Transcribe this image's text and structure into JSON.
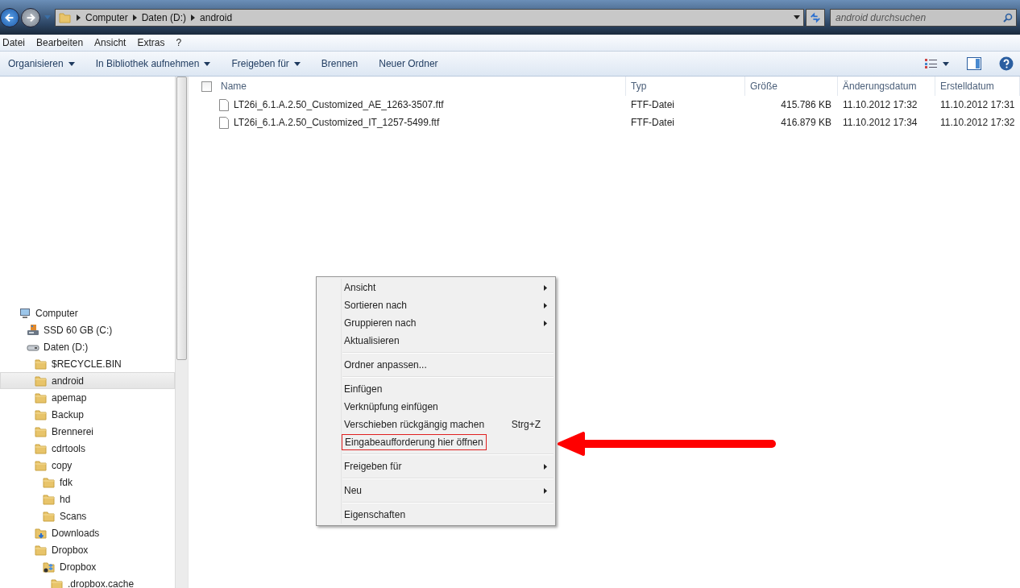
{
  "address_bar": {
    "crumbs": [
      "Computer",
      "Daten (D:)",
      "android"
    ]
  },
  "search": {
    "placeholder": "android durchsuchen"
  },
  "menu_bar": [
    "Datei",
    "Bearbeiten",
    "Ansicht",
    "Extras",
    "?"
  ],
  "command_bar": [
    {
      "label": "Organisieren",
      "dropdown": true
    },
    {
      "label": "In Bibliothek aufnehmen",
      "dropdown": true
    },
    {
      "label": "Freigeben für",
      "dropdown": true
    },
    {
      "label": "Brennen",
      "dropdown": false
    },
    {
      "label": "Neuer Ordner",
      "dropdown": false
    }
  ],
  "nav_tree": [
    {
      "label": "Computer",
      "kind": "computer",
      "selected": false,
      "children": [
        {
          "label": "SSD 60 GB (C:)",
          "kind": "system-drive",
          "selected": false
        },
        {
          "label": "Daten (D:)",
          "kind": "drive",
          "selected": false,
          "children": [
            {
              "label": "$RECYCLE.BIN",
              "kind": "folder",
              "selected": false
            },
            {
              "label": "android",
              "kind": "folder",
              "selected": true
            },
            {
              "label": "apemap",
              "kind": "folder",
              "selected": false
            },
            {
              "label": "Backup",
              "kind": "folder",
              "selected": false
            },
            {
              "label": "Brennerei",
              "kind": "folder",
              "selected": false
            },
            {
              "label": "cdrtools",
              "kind": "folder",
              "selected": false
            },
            {
              "label": "copy",
              "kind": "folder",
              "selected": false,
              "children": [
                {
                  "label": "fdk",
                  "kind": "folder",
                  "selected": false
                },
                {
                  "label": "hd",
                  "kind": "folder",
                  "selected": false
                },
                {
                  "label": "Scans",
                  "kind": "folder",
                  "selected": false
                }
              ]
            },
            {
              "label": "Downloads",
              "kind": "downloads",
              "selected": false
            },
            {
              "label": "Dropbox",
              "kind": "folder",
              "selected": false,
              "children": [
                {
                  "label": "Dropbox",
                  "kind": "dropbox",
                  "selected": false,
                  "children": [
                    {
                      "label": ".dropbox.cache",
                      "kind": "folder",
                      "selected": false
                    }
                  ]
                }
              ]
            }
          ]
        }
      ]
    }
  ],
  "table": {
    "select_all": {
      "checked": false
    },
    "columns": [
      "Name",
      "Typ",
      "Größe",
      "Änderungsdatum",
      "Erstelldatum"
    ],
    "rows": [
      {
        "name": "LT26i_6.1.A.2.50_Customized_AE_1263-3507.ftf",
        "type": "FTF-Datei",
        "size": "415.786 KB",
        "modified": "11.10.2012 17:32",
        "created": "11.10.2012 17:31"
      },
      {
        "name": "LT26i_6.1.A.2.50_Customized_IT_1257-5499.ftf",
        "type": "FTF-Datei",
        "size": "416.879 KB",
        "modified": "11.10.2012 17:34",
        "created": "11.10.2012 17:32"
      }
    ]
  },
  "context_menu": [
    {
      "kind": "item",
      "label": "Ansicht",
      "submenu": true,
      "marked": false
    },
    {
      "kind": "item",
      "label": "Sortieren nach",
      "submenu": true,
      "marked": false
    },
    {
      "kind": "item",
      "label": "Gruppieren nach",
      "submenu": true,
      "marked": false
    },
    {
      "kind": "item",
      "label": "Aktualisieren",
      "submenu": false,
      "marked": false
    },
    {
      "kind": "separator"
    },
    {
      "kind": "item",
      "label": "Ordner anpassen...",
      "submenu": false,
      "marked": false
    },
    {
      "kind": "separator"
    },
    {
      "kind": "item",
      "label": "Einfügen",
      "submenu": false,
      "marked": false
    },
    {
      "kind": "item",
      "label": "Verknüpfung einfügen",
      "submenu": false,
      "marked": false
    },
    {
      "kind": "item",
      "label": "Verschieben rückgängig machen",
      "shortcut": "Strg+Z",
      "submenu": false,
      "marked": false
    },
    {
      "kind": "item",
      "label": "Eingabeaufforderung hier öffnen",
      "submenu": false,
      "marked": true
    },
    {
      "kind": "separator"
    },
    {
      "kind": "item",
      "label": "Freigeben für",
      "submenu": true,
      "marked": false
    },
    {
      "kind": "separator"
    },
    {
      "kind": "item",
      "label": "Neu",
      "submenu": true,
      "marked": false
    },
    {
      "kind": "separator"
    },
    {
      "kind": "item",
      "label": "Eigenschaften",
      "submenu": false,
      "marked": false
    }
  ]
}
